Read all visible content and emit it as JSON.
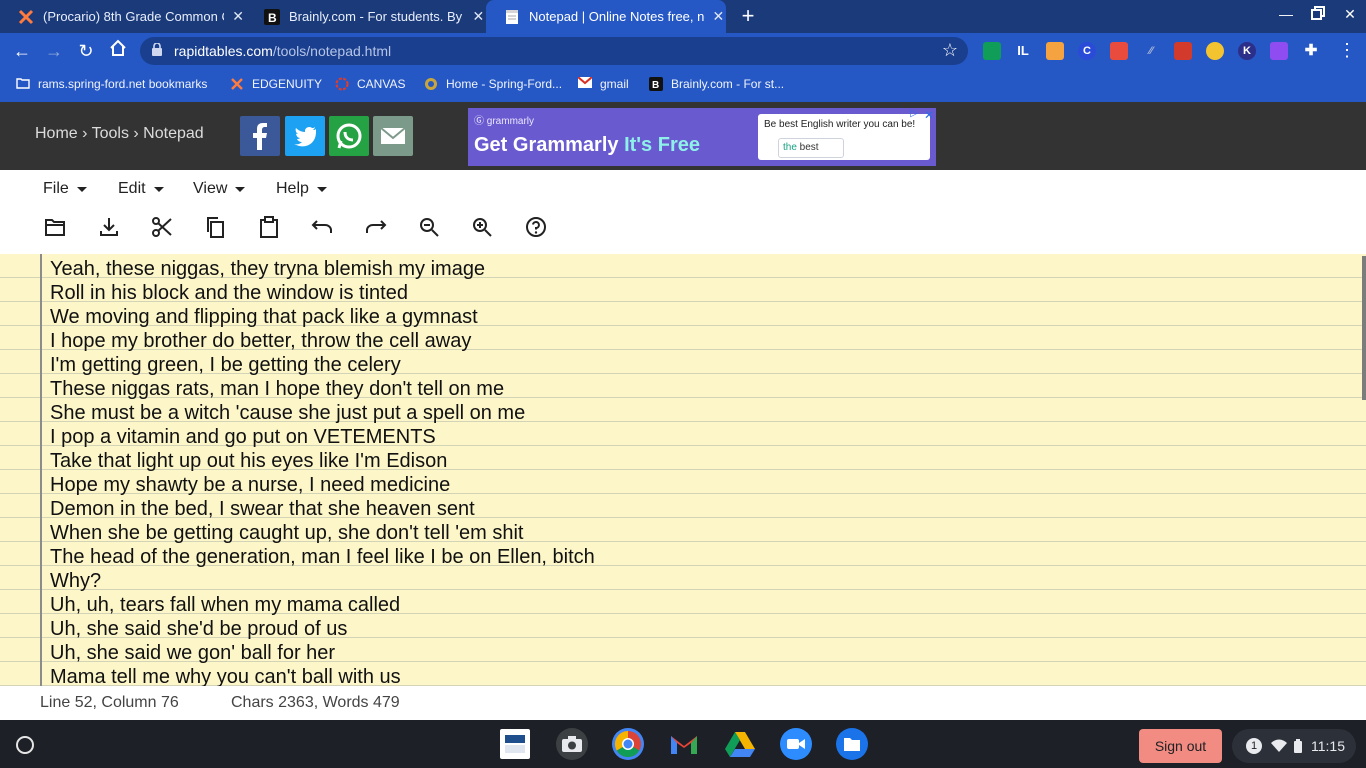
{
  "browser": {
    "tabs": [
      {
        "title": "(Procario) 8th Grade Common C",
        "favicon": "x-logo-icon",
        "active": false
      },
      {
        "title": "Brainly.com - For students. By st",
        "favicon": "brainly-icon",
        "active": false
      },
      {
        "title": "Notepad | Online Notes free, no l",
        "favicon": "notepad-icon",
        "active": true
      }
    ],
    "new_tab_label": "+",
    "url_host": "rapidtables.com",
    "url_path": "/tools/notepad.html",
    "extensions": [
      "google-classroom-icon",
      "il-icon",
      "paint-icon",
      "c-icon",
      "screen-recorder-icon",
      "grey-ext-icon",
      "red-ext-icon",
      "green-ext-icon",
      "k-icon",
      "purple-ext-icon",
      "puzzle-icon"
    ],
    "ext_letters": {
      "il": "IL",
      "c": "C",
      "k": "K"
    }
  },
  "bookmarks": [
    {
      "label": "rams.spring-ford.net bookmarks",
      "icon": "folder-icon"
    },
    {
      "label": "EDGENUITY",
      "icon": "edgenuity-icon"
    },
    {
      "label": "CANVAS",
      "icon": "canvas-icon"
    },
    {
      "label": "Home - Spring-Ford...",
      "icon": "springford-icon"
    },
    {
      "label": "gmail",
      "icon": "gmail-icon"
    },
    {
      "label": "Brainly.com - For st...",
      "icon": "brainly-icon"
    }
  ],
  "site": {
    "breadcrumb": "Home › Tools › Notepad",
    "social": [
      "facebook-icon",
      "twitter-icon",
      "whatsapp-icon",
      "email-icon"
    ],
    "ad": {
      "brand": "grammarly",
      "headline_main": "Get Grammarly ",
      "headline_accent": "It's Free",
      "card_line": "Be best English writer you can be!",
      "card_suggestion_prefix": "the",
      "card_suggestion_word": " best"
    }
  },
  "menu": [
    {
      "label": "File"
    },
    {
      "label": "Edit"
    },
    {
      "label": "View"
    },
    {
      "label": "Help"
    }
  ],
  "toolbar_icons": [
    "open-folder-icon",
    "download-icon",
    "cut-icon",
    "copy-icon",
    "paste-icon",
    "undo-icon",
    "redo-icon",
    "zoom-out-icon",
    "zoom-in-icon",
    "help-icon"
  ],
  "editor": {
    "lines": [
      "Yeah, these niggas, they tryna blemish my image",
      "Roll in his block and the window is tinted",
      "We moving and flipping that pack like a gymnast",
      "I hope my brother do better, throw the cell away",
      "I'm getting green, I be getting the celery",
      "These niggas rats, man I hope they don't tell on me",
      "She must be a witch 'cause she just put a spell on me",
      "I pop a vitamin and go put on VETEMENTS",
      "Take that light up out his eyes like I'm Edison",
      "Hope my shawty be a nurse, I need medicine",
      "Demon in the bed, I swear that she heaven sent",
      "When she be getting caught up, she don't tell 'em shit",
      "The head of the generation, man I feel like I be on Ellen, bitch",
      "Why?",
      "Uh, uh, tears fall when my mama called",
      "Uh, she said she'd be proud of us",
      "Uh, she said we gon' ball for her",
      "Mama tell me why you can't ball with us"
    ]
  },
  "status": {
    "position": "Line 52, Column 76",
    "counts": "Chars 2363, Words 479"
  },
  "shelf": {
    "apps": [
      "pearson-testnav-icon",
      "camera-icon",
      "chrome-icon",
      "gmail-icon",
      "google-drive-icon",
      "zoom-icon",
      "files-icon"
    ],
    "sign_out": "Sign out",
    "notification_count": "1",
    "time": "11:15"
  }
}
